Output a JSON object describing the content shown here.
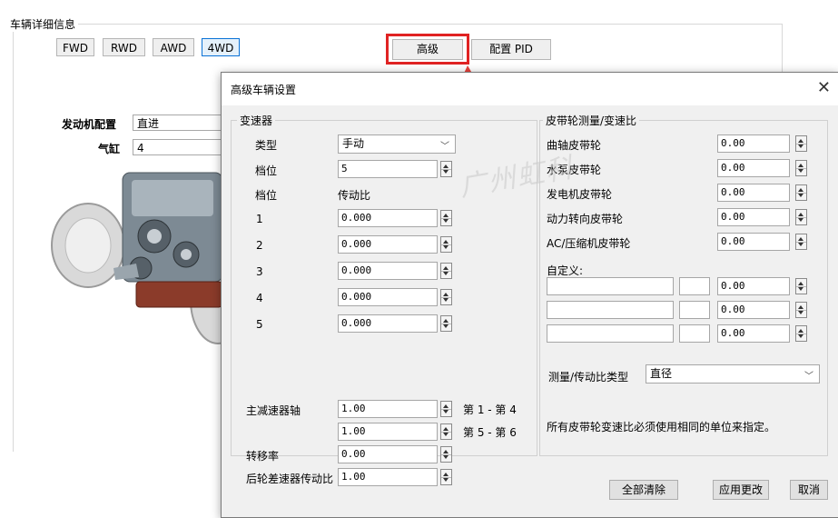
{
  "background": {
    "group_title": "车辆详细信息",
    "drive_buttons": [
      "FWD",
      "RWD",
      "AWD",
      "4WD"
    ],
    "selected_drive": "4WD",
    "advanced_button": "高级",
    "config_pid_button": "配置 PID",
    "engine_config_label": "发动机配置",
    "engine_config_value": "直进",
    "cylinders_label": "气缸",
    "cylinders_value": "4"
  },
  "dialog": {
    "title": "高级车辆设置",
    "close_icon": "close-icon",
    "transmission": {
      "title": "变速器",
      "type_label": "类型",
      "type_value": "手动",
      "gear_count_label": "档位",
      "gear_count_value": "5",
      "gear_col_label": "档位",
      "ratio_col_label": "传动比",
      "gears": [
        {
          "gear": "1",
          "ratio": "0.000"
        },
        {
          "gear": "2",
          "ratio": "0.000"
        },
        {
          "gear": "3",
          "ratio": "0.000"
        },
        {
          "gear": "4",
          "ratio": "0.000"
        },
        {
          "gear": "5",
          "ratio": "0.000"
        }
      ]
    },
    "final_drive_label": "主减速器轴",
    "final_drive_1": "1.00",
    "final_drive_1_note": "第 1 - 第 4",
    "final_drive_2": "1.00",
    "final_drive_2_note": "第 5 - 第 6",
    "transfer_label": "转移率",
    "transfer_value": "0.00",
    "rear_diff_label": "后轮差速器传动比",
    "rear_diff_value": "1.00",
    "belts": {
      "title": "皮带轮测量/变速比",
      "items": [
        {
          "label": "曲轴皮带轮",
          "value": "0.00"
        },
        {
          "label": "水泵皮带轮",
          "value": "0.00"
        },
        {
          "label": "发电机皮带轮",
          "value": "0.00"
        },
        {
          "label": "动力转向皮带轮",
          "value": "0.00"
        },
        {
          "label": "AC/压缩机皮带轮",
          "value": "0.00"
        }
      ],
      "custom_label": "自定义:",
      "custom_rows": [
        {
          "name": "",
          "code": "",
          "value": "0.00"
        },
        {
          "name": "",
          "code": "",
          "value": "0.00"
        },
        {
          "name": "",
          "code": "",
          "value": "0.00"
        }
      ],
      "measure_type_label": "测量/传动比类型",
      "measure_type_value": "直径",
      "note": "所有皮带轮变速比必须使用相同的单位来指定。"
    },
    "clear_all_button": "全部清除",
    "apply_button": "应用更改",
    "cancel_button": "取消"
  },
  "watermark": "广州虹科",
  "colors": {
    "highlight_red": "#e02323",
    "arrow_red": "#e8413a",
    "selected_blue": "#0a72d6"
  }
}
